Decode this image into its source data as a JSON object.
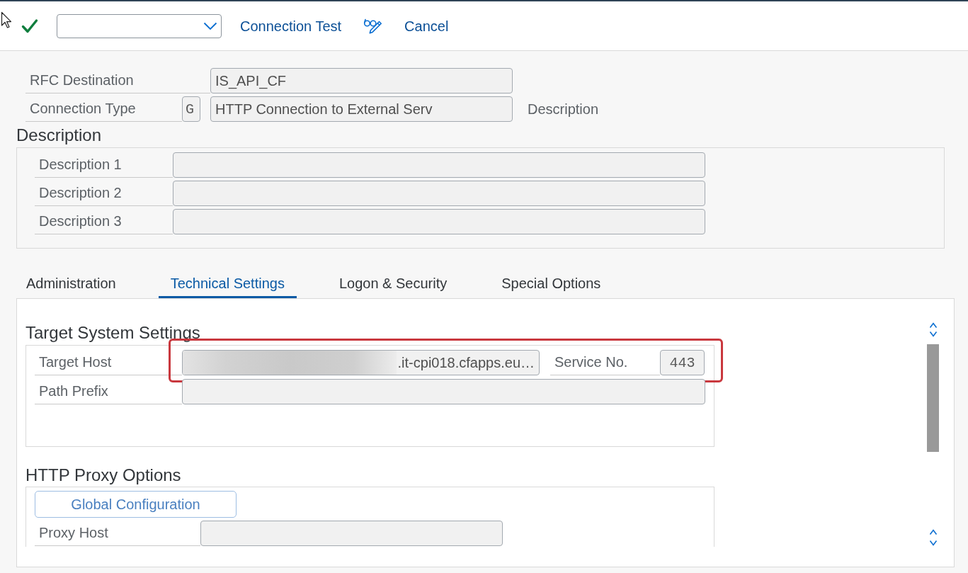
{
  "toolbar": {
    "items": [
      {
        "kind": "check"
      },
      {
        "kind": "dropdown"
      },
      {
        "kind": "link",
        "label": "Connection Test"
      },
      {
        "kind": "icon"
      },
      {
        "kind": "link",
        "label": "Cancel"
      }
    ]
  },
  "header": {
    "fields": [
      {
        "label": "RFC Destination",
        "value": "IS_API_CF"
      },
      {
        "label": "Connection Type",
        "code": "G",
        "value": "HTTP Connection to External Serv",
        "note": "Description"
      }
    ]
  },
  "description": {
    "title": "Description",
    "fields": [
      {
        "label": "Description 1"
      },
      {
        "label": "Description 2"
      },
      {
        "label": "Description 3"
      }
    ]
  },
  "tabs": [
    {
      "label": "Administration",
      "selected": false
    },
    {
      "label": "Technical Settings",
      "selected": true
    },
    {
      "label": "Logon & Security",
      "selected": false
    },
    {
      "label": "Special Options",
      "selected": false
    }
  ],
  "tab_panel": {
    "sections": [
      {
        "title": "Target System Settings",
        "rows": [
          {
            "label": "Target Host",
            "value": ".it-cpi018.cfapps.eu…",
            "redacted": true,
            "highlighted": true,
            "extra": {
              "label": "Service No.",
              "value": "443"
            }
          },
          {
            "label": "Path Prefix",
            "redacted": false,
            "highlighted": false
          }
        ]
      },
      {
        "title": "HTTP Proxy Options",
        "button": "Global Configuration",
        "rows": [
          {
            "label": "Proxy Host",
            "redacted": false,
            "highlighted": false
          }
        ]
      }
    ]
  }
}
